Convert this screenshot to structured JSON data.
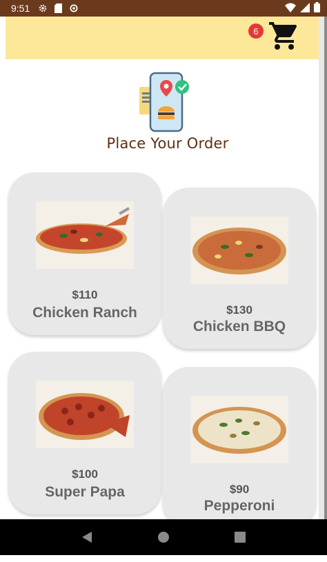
{
  "status_bar": {
    "time": "9:51",
    "left_icons": [
      "gear-icon",
      "sd-card-icon",
      "sync-icon"
    ],
    "right_icons": [
      "wifi-icon",
      "signal-icon",
      "battery-icon"
    ]
  },
  "app_bar": {
    "cart_icon": "shopping-cart-icon",
    "cart_count": "6",
    "background": "#fde89a"
  },
  "header": {
    "title": "Place Your Order",
    "illustration": "phone-order-illustration"
  },
  "products": [
    {
      "name": "Chicken Ranch",
      "price": "$110"
    },
    {
      "name": "Chicken BBQ",
      "price": "$130"
    },
    {
      "name": "Super Papa",
      "price": "$100"
    },
    {
      "name": "Pepperoni",
      "price": "$90"
    }
  ],
  "nav_bar": {
    "buttons": [
      "back-icon",
      "home-icon",
      "recents-icon"
    ]
  },
  "colors": {
    "status_bar": "#6b3a1c",
    "card": "#e8e8e8",
    "title": "#5b2f14",
    "badge": "#e53935"
  }
}
